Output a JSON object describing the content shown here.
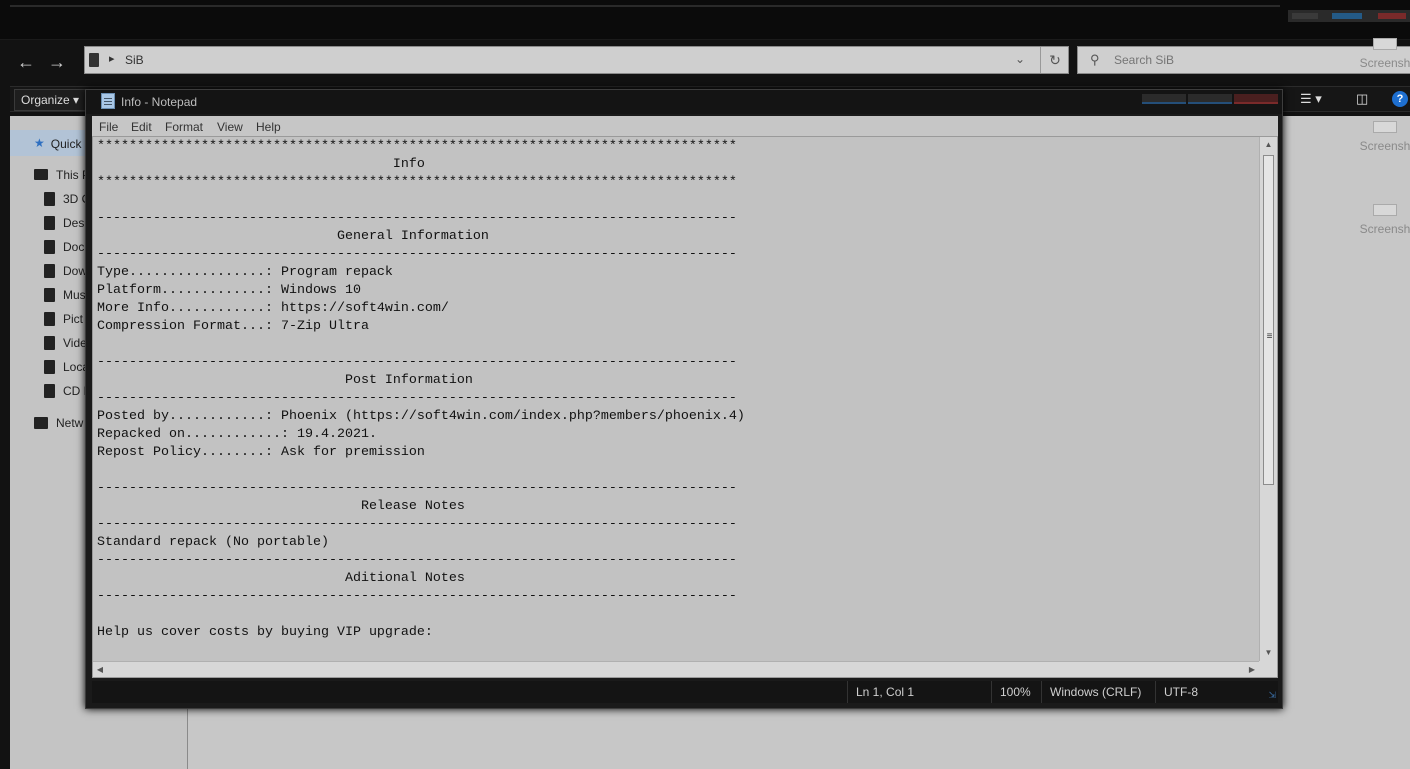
{
  "explorer": {
    "path": "SiB",
    "search_placeholder": "Search SiB",
    "organize_label": "Organize",
    "nav_items": [
      {
        "label": "Quick",
        "icon": "star-icon"
      },
      {
        "label": "This P",
        "icon": "computer-icon"
      },
      {
        "label": "3D O",
        "icon": "folder-3d-icon"
      },
      {
        "label": "Desk",
        "icon": "desktop-icon"
      },
      {
        "label": "Docu",
        "icon": "documents-icon"
      },
      {
        "label": "Dow",
        "icon": "downloads-icon"
      },
      {
        "label": "Mus",
        "icon": "music-icon"
      },
      {
        "label": "Pict",
        "icon": "pictures-icon"
      },
      {
        "label": "Vide",
        "icon": "videos-icon"
      },
      {
        "label": "Loca",
        "icon": "drive-icon"
      },
      {
        "label": "CD D",
        "icon": "cd-drive-icon"
      },
      {
        "label": "Netw",
        "icon": "network-icon"
      }
    ],
    "right_items": [
      "Screensh",
      "Screensh",
      "Screensh"
    ]
  },
  "notepad": {
    "title": "Info - Notepad",
    "menu": [
      "File",
      "Edit",
      "Format",
      "View",
      "Help"
    ],
    "content": "********************************************************************************\n                                     Info\n********************************************************************************\n\n--------------------------------------------------------------------------------\n                              General Information\n--------------------------------------------------------------------------------\nType.................: Program repack\nPlatform.............: Windows 10\nMore Info............: https://soft4win.com/\nCompression Format...: 7-Zip Ultra\n\n--------------------------------------------------------------------------------\n                               Post Information\n--------------------------------------------------------------------------------\nPosted by............: Phoenix (https://soft4win.com/index.php?members/phoenix.4)\nRepacked on............: 19.4.2021.\nRepost Policy........: Ask for premission\n\n--------------------------------------------------------------------------------\n                                 Release Notes\n--------------------------------------------------------------------------------\nStandard repack (No portable)\n--------------------------------------------------------------------------------\n                               Aditional Notes\n--------------------------------------------------------------------------------\n\nHelp us cover costs by buying VIP upgrade:",
    "status": {
      "position": "Ln 1, Col 1",
      "zoom": "100%",
      "line_ending": "Windows (CRLF)",
      "encoding": "UTF-8"
    }
  }
}
